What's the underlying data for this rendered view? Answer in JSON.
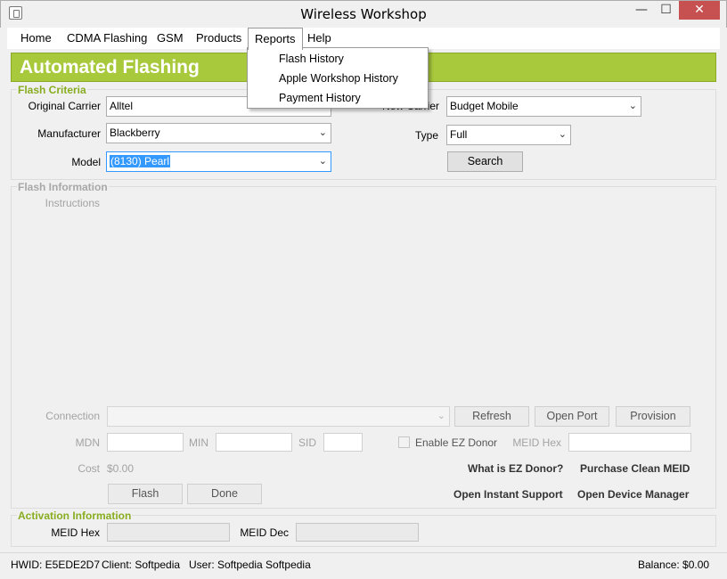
{
  "window": {
    "title": "Wireless Workshop",
    "minimize": "—",
    "maximize": "☐",
    "close": "✕"
  },
  "menu": {
    "items": [
      "Home",
      "CDMA Flashing",
      "GSM",
      "Products",
      "Reports",
      "Help"
    ]
  },
  "reports_menu": {
    "items": [
      "Flash History",
      "Apple Workshop History",
      "Payment History"
    ]
  },
  "header": {
    "title": "Automated Flashing"
  },
  "flash_criteria": {
    "group_label": "Flash Criteria",
    "original_carrier_label": "Original Carrier",
    "original_carrier_value": "Alltel",
    "new_carrier_label": "New Carrier",
    "new_carrier_value": "Budget Mobile",
    "manufacturer_label": "Manufacturer",
    "manufacturer_value": "Blackberry",
    "type_label": "Type",
    "type_value": "Full",
    "model_label": "Model",
    "model_value": "(8130) Pearl",
    "search_button": "Search"
  },
  "flash_info": {
    "group_label": "Flash Information",
    "instructions_label": "Instructions",
    "connection_label": "Connection",
    "refresh_button": "Refresh",
    "open_port_button": "Open Port",
    "provision_button": "Provision",
    "mdn_label": "MDN",
    "min_label": "MIN",
    "sid_label": "SID",
    "ez_donor_label": "Enable EZ Donor",
    "meid_hex_label": "MEID Hex",
    "cost_label": "Cost",
    "cost_value": "$0.00",
    "what_is_ez_donor": "What is EZ Donor?",
    "purchase_clean_meid": "Purchase Clean MEID",
    "flash_button": "Flash",
    "done_button": "Done",
    "open_instant_support": "Open Instant Support",
    "open_device_manager": "Open Device Manager"
  },
  "activation": {
    "group_label": "Activation Information",
    "meid_hex_label": "MEID Hex",
    "meid_dec_label": "MEID Dec"
  },
  "status": {
    "hwid": "HWID: E5EDE2D7",
    "client": "Client: Softpedia",
    "user": "User: Softpedia Softpedia",
    "balance": "Balance: $0.00"
  },
  "colors": {
    "header_green": "#a9c93c",
    "group_label_green": "#88ad20",
    "selection_blue": "#3399ff",
    "close_red": "#c75050"
  }
}
